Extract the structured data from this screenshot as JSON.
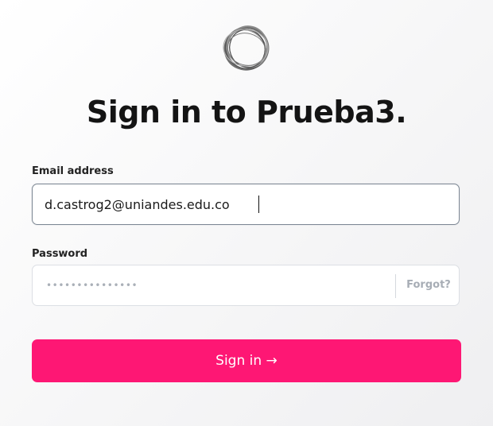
{
  "logo": {
    "icon": "swirl-ring-logo-icon"
  },
  "title": "Sign in to Prueba3.",
  "email": {
    "label": "Email address",
    "value": "d.castrog2@uniandes.edu.co"
  },
  "password": {
    "label": "Password",
    "masked_value": "•••••••••••••••",
    "forgot_label": "Forgot?"
  },
  "signin": {
    "label": "Sign in →"
  },
  "colors": {
    "accent": "#fe1774",
    "focus_border": "#7d8794",
    "muted_text": "#a7adb5"
  }
}
